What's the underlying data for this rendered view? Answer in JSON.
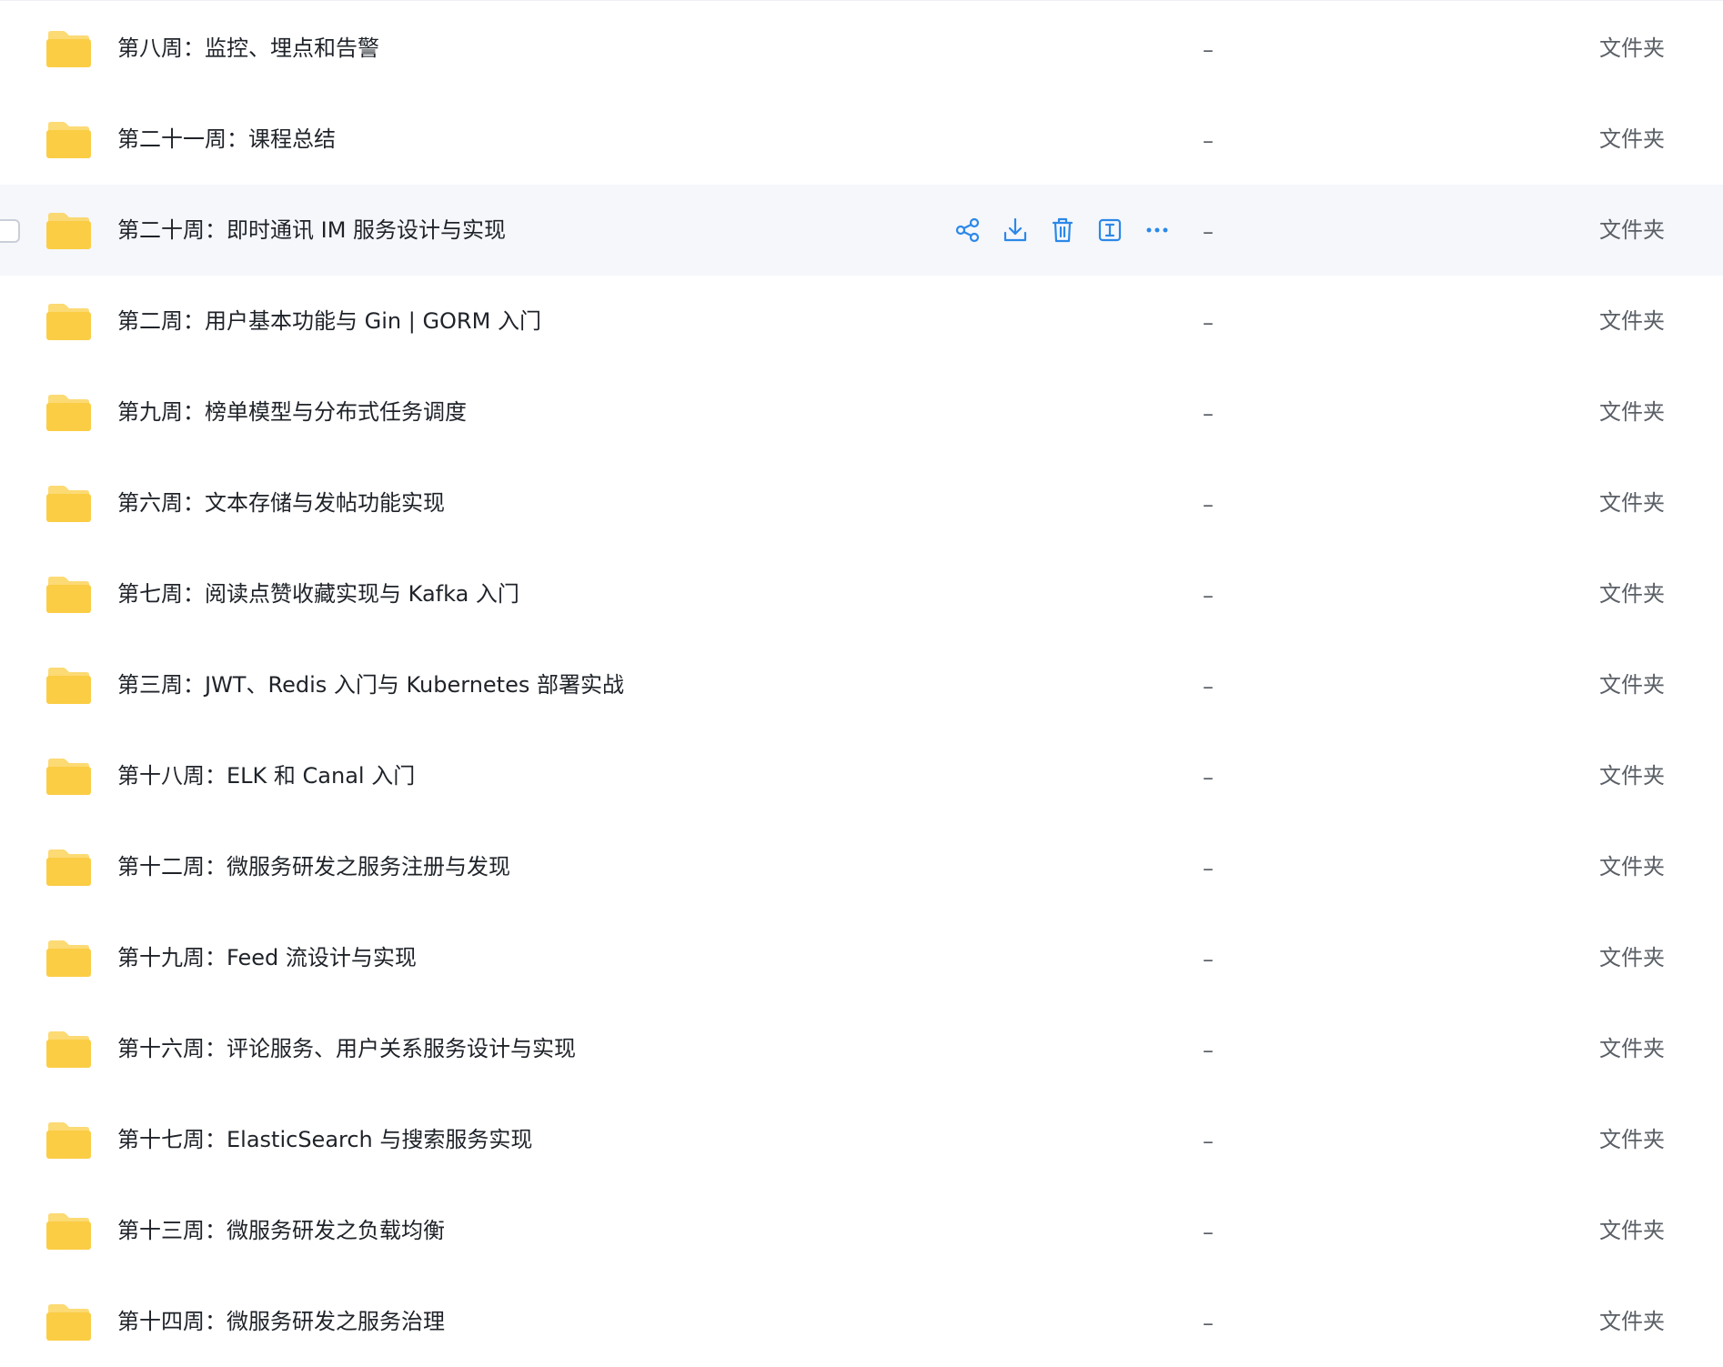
{
  "colors": {
    "folder": "#fbcd45",
    "action": "#2c88e8",
    "hover_row": "#f5f7fb"
  },
  "action_icons": [
    "share-icon",
    "download-icon",
    "trash-icon",
    "rename-icon",
    "more-icon"
  ],
  "files": [
    {
      "name": "第八周：监控、埋点和告警",
      "size": "–",
      "type": "文件夹",
      "hovered": false
    },
    {
      "name": "第二十一周：课程总结",
      "size": "–",
      "type": "文件夹",
      "hovered": false
    },
    {
      "name": "第二十周：即时通讯 IM 服务设计与实现",
      "size": "–",
      "type": "文件夹",
      "hovered": true
    },
    {
      "name": "第二周：用户基本功能与 Gin | GORM 入门",
      "size": "–",
      "type": "文件夹",
      "hovered": false
    },
    {
      "name": "第九周：榜单模型与分布式任务调度",
      "size": "–",
      "type": "文件夹",
      "hovered": false
    },
    {
      "name": "第六周：文本存储与发帖功能实现",
      "size": "–",
      "type": "文件夹",
      "hovered": false
    },
    {
      "name": "第七周：阅读点赞收藏实现与 Kafka 入门",
      "size": "–",
      "type": "文件夹",
      "hovered": false
    },
    {
      "name": "第三周：JWT、Redis 入门与 Kubernetes 部署实战",
      "size": "–",
      "type": "文件夹",
      "hovered": false
    },
    {
      "name": "第十八周：ELK 和 Canal 入门",
      "size": "–",
      "type": "文件夹",
      "hovered": false
    },
    {
      "name": "第十二周：微服务研发之服务注册与发现",
      "size": "–",
      "type": "文件夹",
      "hovered": false
    },
    {
      "name": "第十九周：Feed 流设计与实现",
      "size": "–",
      "type": "文件夹",
      "hovered": false
    },
    {
      "name": "第十六周：评论服务、用户关系服务设计与实现",
      "size": "–",
      "type": "文件夹",
      "hovered": false
    },
    {
      "name": "第十七周：ElasticSearch 与搜索服务实现",
      "size": "–",
      "type": "文件夹",
      "hovered": false
    },
    {
      "name": "第十三周：微服务研发之负载均衡",
      "size": "–",
      "type": "文件夹",
      "hovered": false
    },
    {
      "name": "第十四周：微服务研发之服务治理",
      "size": "–",
      "type": "文件夹",
      "hovered": false
    }
  ]
}
